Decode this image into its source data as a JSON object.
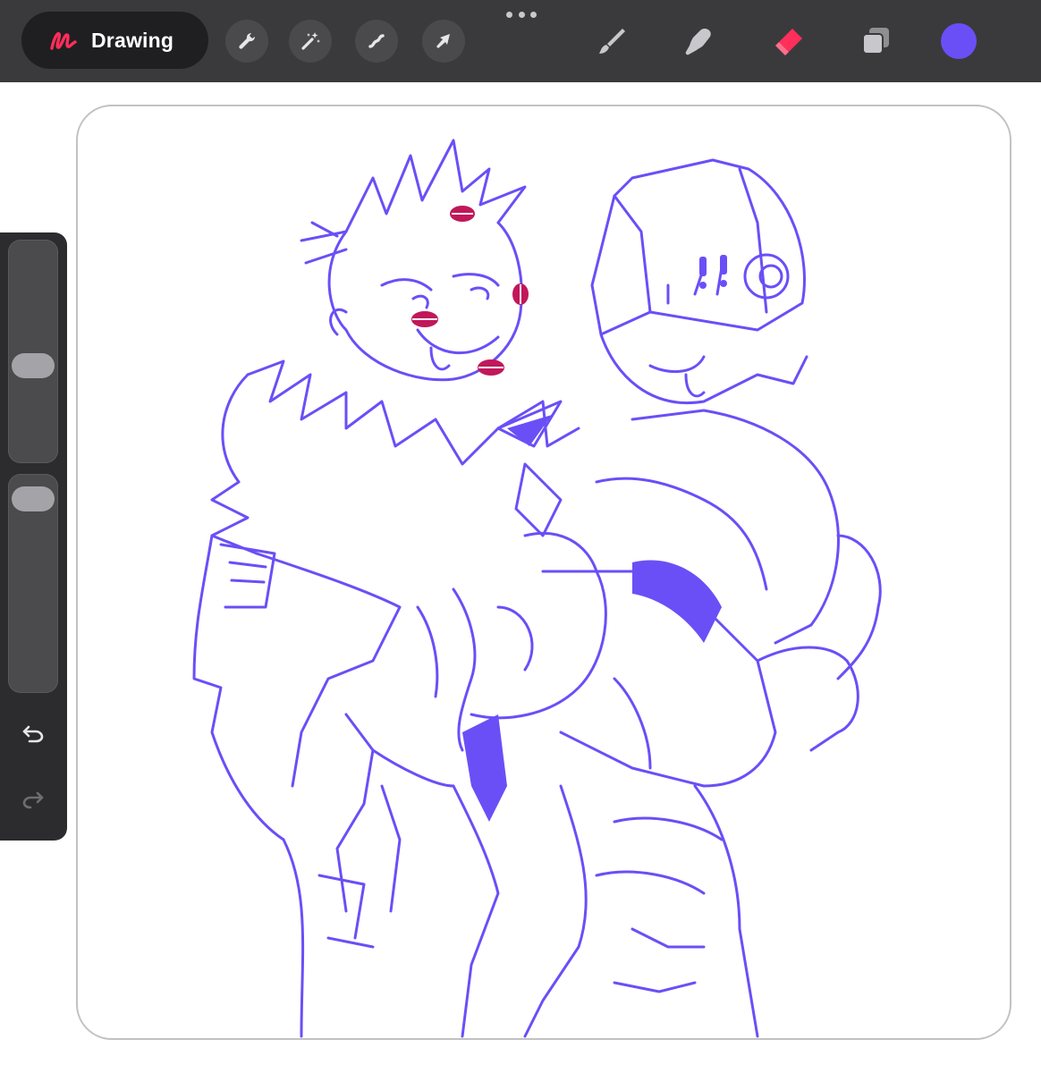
{
  "toolbar": {
    "app_label": "Drawing",
    "left_tools": [
      "wrench-icon",
      "magic-wand-icon",
      "selection-icon",
      "transform-arrow-icon"
    ],
    "right_tools": [
      "brush-icon",
      "smudge-icon",
      "eraser-icon",
      "layers-icon"
    ],
    "active_color": "#6a4ff7",
    "accent_color": "#ff2e5a"
  },
  "sidebar": {
    "brush_size_level": 0.42,
    "opacity_level": 0.03,
    "undo": "undo-icon",
    "redo": "redo-icon"
  },
  "canvas": {
    "stroke_color": "#6a4ff7",
    "mark_color": "#c0185a"
  }
}
